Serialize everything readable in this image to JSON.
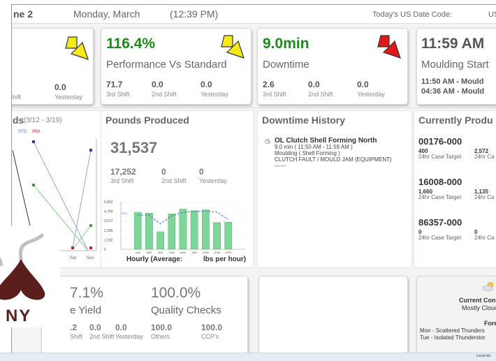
{
  "header": {
    "line_label": "ne 2",
    "date": "Monday, March",
    "time": "(12:39 PM)",
    "date_code_label": "Today's US Date Code:",
    "date_code_value": "US"
  },
  "cards": {
    "partial_left": {
      "shifts": [
        {
          "label": "Shift"
        },
        {
          "value": "0.0",
          "label": "Yesterday"
        }
      ]
    },
    "performance": {
      "value": "116.4%",
      "title": "Performance Vs Standard",
      "value_color": "#1a8a1a",
      "indicator": "yellow-down-right-arrow",
      "shifts": [
        {
          "value": "71.7",
          "label": "3rd Shift"
        },
        {
          "value": "0.0",
          "label": "2nd Shift"
        },
        {
          "value": "0.0",
          "label": "Yesterday"
        }
      ]
    },
    "downtime": {
      "value": "9.0min",
      "title": "Downtime",
      "value_color": "#1a8a1a",
      "indicator": "red-down-right-arrow",
      "shifts": [
        {
          "value": "2.6",
          "label": "3rd Shift"
        },
        {
          "value": "0.0",
          "label": "2nd Shift"
        },
        {
          "value": "0.0",
          "label": "Yesterday"
        }
      ]
    },
    "moulding": {
      "value": "11:59 AM",
      "title": "Moulding Start",
      "lines": [
        "11:50 AM - Mould",
        "04:36 AM - Mould"
      ]
    },
    "trends": {
      "title": "ds",
      "range": "(3/12 - 3/19)",
      "legend": [
        "STD",
        "IRM"
      ],
      "x_labels": [
        "Sat",
        "Sun"
      ]
    },
    "pounds": {
      "title": "Pounds Produced",
      "value": "31,537",
      "shifts": [
        {
          "value": "17,252",
          "label": "3rd Shift"
        },
        {
          "value": "0",
          "label": "2nd Shift"
        },
        {
          "value": "0",
          "label": "Yesterday"
        }
      ],
      "caption_left": "Hourly (Average:",
      "caption_right": "lbs per hour)"
    },
    "history": {
      "title": "Downtime History",
      "entry": {
        "title": "OL Clutch Shell Forming North",
        "lines": [
          "9.0 min ( 11:50 AM - 11:59 AM )",
          "Moulding ( Shell Forming )",
          "CLUTCH FAULT / MOULD JAM (EQUIPMENT)",
          "------"
        ]
      }
    },
    "producing": {
      "title": "Currently Produ",
      "items": [
        {
          "id": "00176-000",
          "target": "400",
          "target_label": "24hr Case Target",
          "actual": "2,572",
          "actual_label": "24hr Ca"
        },
        {
          "id": "16008-000",
          "target": "1,660",
          "target_label": "24hr Case Target",
          "actual": "1,135",
          "actual_label": "24hr Ca"
        },
        {
          "id": "86357-000",
          "target": "0",
          "target_label": "24hr Case Target",
          "actual": "0",
          "actual_label": "24hr Ca"
        }
      ]
    },
    "yield": {
      "value": "7.1%",
      "title": "e Yield",
      "shifts": [
        {
          "value": ".2",
          "label": "Shift"
        },
        {
          "value": "0.0",
          "label": "2nd Shift"
        },
        {
          "value": "0.0",
          "label": "Yesterday"
        }
      ]
    },
    "quality": {
      "value": "100.0%",
      "title": "Quality Checks",
      "shifts": [
        {
          "value": "100.0",
          "label": "Others"
        },
        {
          "value": "100.0",
          "label": "CCP's"
        }
      ]
    },
    "weather": {
      "current_label": "Current Con",
      "current": "Mostly Clouc",
      "forecast_label": "Foreca",
      "forecast": [
        "Mon - Scattered Thunders",
        "Tue - Isolated Thunderstor"
      ]
    }
  },
  "logo": {
    "text": "NY"
  },
  "taskbar": {
    "label": "Local intr"
  },
  "chart_data": {
    "type": "bar",
    "categories": [
      "",
      "",
      "",
      "",
      "",
      "",
      "",
      "",
      "",
      "",
      ""
    ],
    "tick_labels": [
      "",
      "4AM",
      "5AM",
      "6AM",
      "7AM",
      "8AM",
      "9AM",
      "10AM",
      "11AM",
      "12PM",
      ""
    ],
    "values": [
      0,
      4650,
      4550,
      2200,
      4450,
      5050,
      4850,
      4950,
      3350,
      3400,
      0
    ],
    "avg_line": [
      null,
      4300,
      4300,
      3200,
      4200,
      4650,
      4750,
      4800,
      4650,
      3750,
      null
    ],
    "y_ticks": [
      "5,962",
      "4,769",
      "3,577",
      "2,385",
      "1,192",
      "0"
    ],
    "avg_label": "STD",
    "ylim": [
      0,
      5962
    ],
    "bar_color": "#7fd49a",
    "line_color": "#3f6fd6"
  }
}
